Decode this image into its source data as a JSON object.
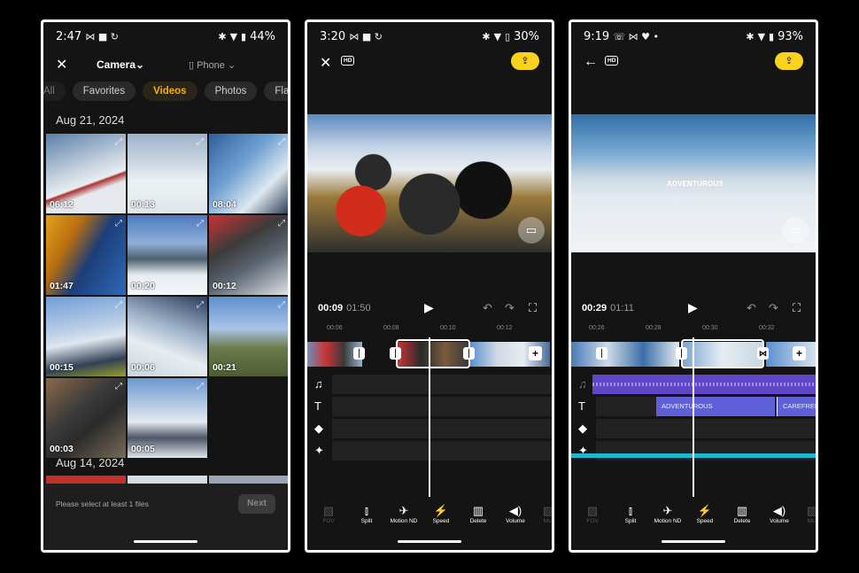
{
  "phone1": {
    "status": {
      "time": "2:47",
      "battery": "44%",
      "icons": "⋈ ■ ↻"
    },
    "top": {
      "close": "✕",
      "camera": "Camera⌄",
      "phone": "▯ Phone ⌄"
    },
    "chips": [
      "All",
      "Favorites",
      "Videos",
      "Photos",
      "Flat"
    ],
    "active_chip": "Videos",
    "date1": "Aug 21, 2024",
    "date2": "Aug 14, 2024",
    "durations": [
      "06:12",
      "00:13",
      "08:04",
      "01:47",
      "00:20",
      "00:12",
      "00:15",
      "00:06",
      "00:21",
      "00:03",
      "00:05"
    ],
    "hint": "Please select at least 1 files",
    "next": "Next"
  },
  "phone2": {
    "status": {
      "time": "3:20",
      "battery": "30%",
      "icons": "⋈ ■ ↻"
    },
    "time_current": "00:09",
    "time_total": "01:50",
    "ruler": [
      "00:06",
      "00:08",
      "00:10",
      "00:12"
    ]
  },
  "phone3": {
    "status": {
      "time": "9:19",
      "battery": "93%",
      "icons": "☏ ⋈ ♥ •"
    },
    "time_current": "00:29",
    "time_total": "01:11",
    "ruler": [
      "00:26",
      "00:28",
      "00:30",
      "00:32"
    ],
    "overlay_text": "ADVENTUROUS",
    "text_clips": [
      "ADVENTUROUS",
      "CAREFREE"
    ]
  },
  "tools": [
    "FOV",
    "Split",
    "Motion ND",
    "Speed",
    "Delete",
    "Volume",
    "Mut"
  ],
  "colors": {
    "accent_yellow": "#f8d21c",
    "video_chip": "#f0b400",
    "audio_track": "#5f47c7",
    "cyan_track": "#1fb8d0"
  }
}
